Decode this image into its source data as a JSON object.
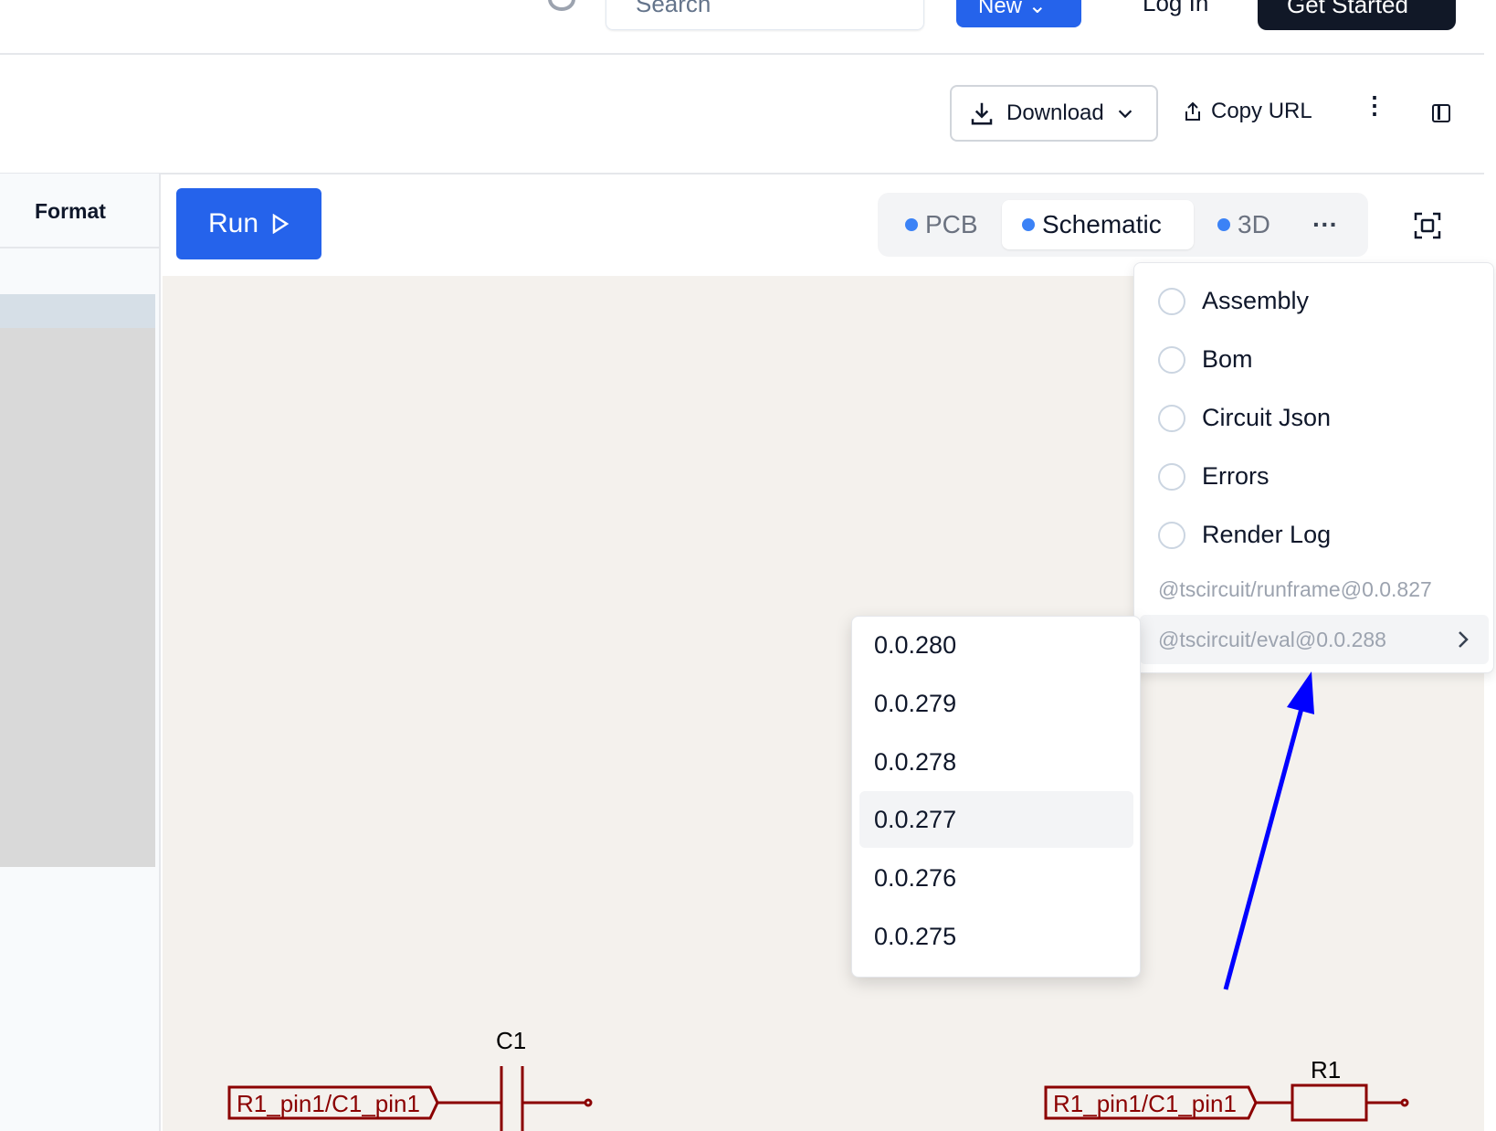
{
  "topbar": {
    "search_placeholder": "Search",
    "new_label": "New",
    "login_label": "Log In",
    "get_started_label": "Get Started"
  },
  "toolbar": {
    "download_label": "Download",
    "copy_url_label": "Copy URL"
  },
  "sidebar": {
    "format_label": "Format"
  },
  "editor": {
    "run_label": "Run"
  },
  "view_tabs": [
    {
      "label": "PCB"
    },
    {
      "label": "Schematic"
    },
    {
      "label": "3D"
    }
  ],
  "view_menu": {
    "items": [
      {
        "label": "Assembly"
      },
      {
        "label": "Bom"
      },
      {
        "label": "Circuit Json"
      },
      {
        "label": "Errors"
      },
      {
        "label": "Render Log"
      }
    ],
    "runframe_version": "@tscircuit/runframe@0.0.827",
    "eval_version": "@tscircuit/eval@0.0.288"
  },
  "version_submenu": {
    "items": [
      "0.0.280",
      "0.0.279",
      "0.0.278",
      "0.0.277",
      "0.0.276",
      "0.0.275"
    ],
    "highlighted": "0.0.277"
  },
  "schematic": {
    "c1_label": "C1",
    "r1_label": "R1",
    "net_label_left": "R1_pin1/C1_pin1",
    "net_label_right": "R1_pin1/C1_pin1",
    "wire_color": "#8b0000"
  },
  "annotation": {
    "arrow_color": "#0000ff"
  }
}
